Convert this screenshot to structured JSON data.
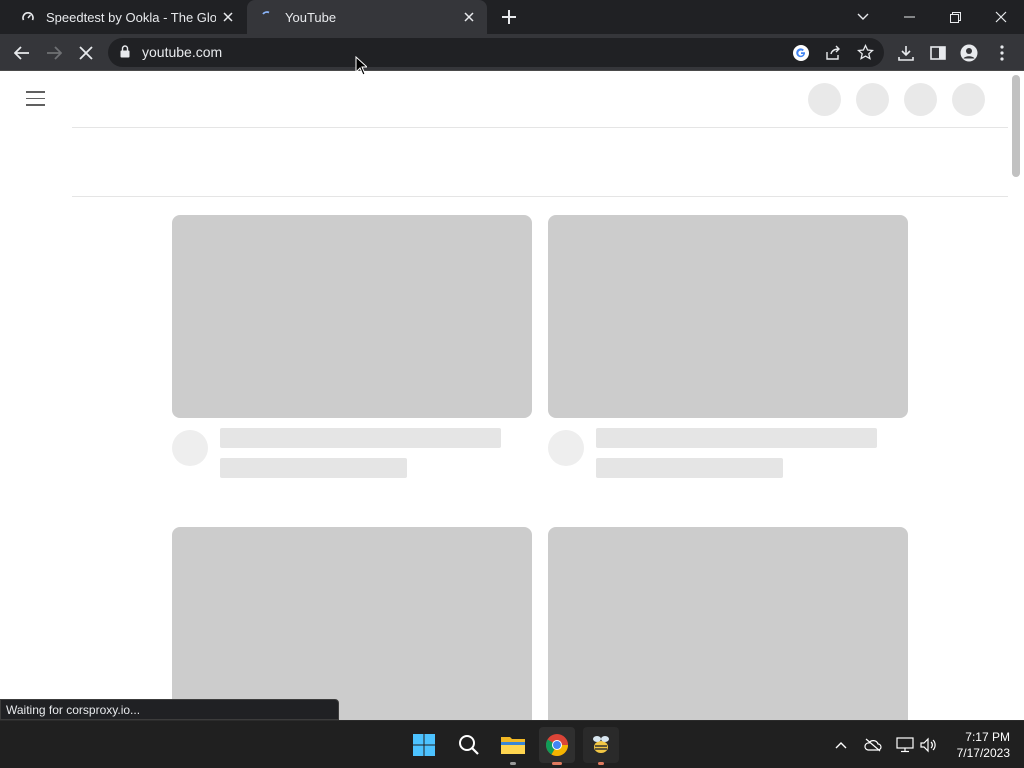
{
  "browser": {
    "tabs": [
      {
        "title": "Speedtest by Ookla - The Global",
        "active": false,
        "favicon": "speedtest-icon"
      },
      {
        "title": "YouTube",
        "active": true,
        "favicon": "loading-spinner-icon"
      }
    ],
    "url": "youtube.com",
    "status_text": "Waiting for corsproxy.io..."
  },
  "taskbar": {
    "apps": [
      "windows-start-icon",
      "search-icon",
      "file-explorer-icon",
      "chrome-icon",
      "app-icon"
    ],
    "time": "7:17 PM",
    "date": "7/17/2023"
  },
  "colors": {
    "chrome_dark": "#202124",
    "toolbar": "#35363a",
    "skeleton_thumb": "#cccccc",
    "skeleton_text": "#e5e5e5"
  }
}
